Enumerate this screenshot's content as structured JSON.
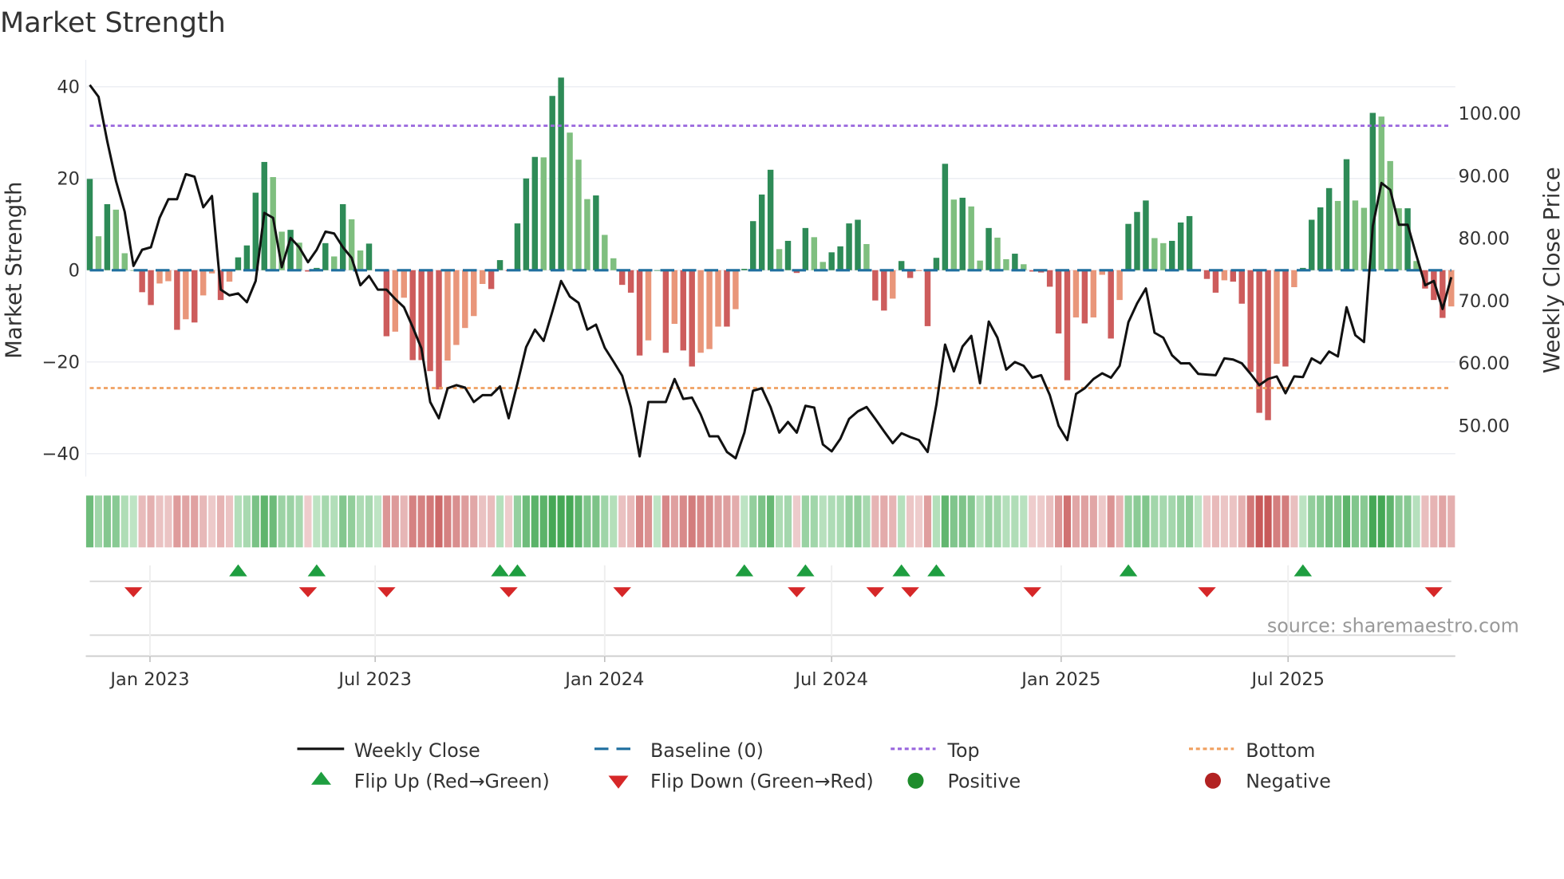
{
  "chart_data": {
    "type": "bar",
    "title": "Market Strength",
    "ylabel": "Market Strength",
    "y2label": "Weekly Close Price",
    "ylim": [
      -44,
      44
    ],
    "y2lim": [
      44.3,
      106.4
    ],
    "yticks": [
      "40",
      "20",
      "0",
      "−20",
      "−40"
    ],
    "ytick_values": [
      40,
      20,
      0,
      -20,
      -40
    ],
    "y2ticks": [
      "100.00",
      "90.00",
      "80.00",
      "70.00",
      "60.00",
      "50.00"
    ],
    "y2tick_values": [
      100,
      90,
      80,
      70,
      60,
      50
    ],
    "xticks": [
      {
        "label": "Jan 2023",
        "week": 6.9
      },
      {
        "label": "Jul 2023",
        "week": 32.7
      },
      {
        "label": "Jan 2024",
        "week": 59
      },
      {
        "label": "Jul 2024",
        "week": 85
      },
      {
        "label": "Jan 2025",
        "week": 111.3
      },
      {
        "label": "Jul 2025",
        "week": 137.3
      }
    ],
    "top_threshold": 31.5,
    "bottom_threshold": -25.7,
    "baseline": 0,
    "strength": [
      19.9,
      7.4,
      14.4,
      13.2,
      3.7,
      0,
      -4.8,
      -7.6,
      -2.9,
      -2.4,
      -13,
      -10.7,
      -11.4,
      -5.5,
      -0.7,
      -6.5,
      -2.5,
      2.8,
      5.4,
      16.9,
      23.6,
      20.3,
      8.4,
      8.8,
      6,
      -0.3,
      0.5,
      5.9,
      3,
      14.4,
      11.1,
      4.3,
      5.8,
      0,
      -14.4,
      -13.4,
      -6,
      -19.6,
      -19.6,
      -22,
      -26,
      -19.7,
      -16.3,
      -12.6,
      -10,
      -3,
      -4.1,
      2.2,
      -0.2,
      10.2,
      20,
      24.7,
      24.6,
      38,
      42,
      30,
      24.1,
      15.5,
      16.3,
      7.7,
      2.6,
      -3.2,
      -4.9,
      -18.6,
      -15.3,
      0,
      -18,
      -11.7,
      -17.5,
      -21,
      -18,
      -17.2,
      -12.3,
      -12.3,
      -8.5,
      0.3,
      10.7,
      16.5,
      21.9,
      4.6,
      6.4,
      -0.6,
      9.2,
      7.2,
      1.8,
      3.9,
      5.2,
      10.2,
      11,
      5.7,
      -6.6,
      -8.8,
      -6.2,
      2.0,
      -1.7,
      -0.2,
      -12.2,
      2.7,
      23.2,
      15.4,
      15.8,
      13.9,
      2.1,
      9.2,
      7.1,
      2.4,
      3.6,
      1.3,
      -0.3,
      -0.5,
      -3.6,
      -13.8,
      -24,
      -10.3,
      -11.6,
      -10.3,
      -1,
      -14.9,
      -6.5,
      10.1,
      12.7,
      15.2,
      7,
      5.9,
      6.4,
      10.4,
      11.8,
      0.2,
      -1.9,
      -4.9,
      -2.2,
      -2.5,
      -7.3,
      -22.2,
      -31.1,
      -32.7,
      -20.4,
      -21,
      -3.7,
      0.5,
      11,
      13.7,
      17.9,
      15.1,
      24.2,
      15.2,
      13.6,
      34.3,
      33.5,
      23.8,
      13.5,
      13.5,
      2,
      -4,
      -6.5,
      -10.4,
      -7.9
    ],
    "weekly_close": [
      104.6,
      102.7,
      95.6,
      89.2,
      84.3,
      75.6,
      78.2,
      78.6,
      83.3,
      86.3,
      86.3,
      90.3,
      89.9,
      85,
      86.8,
      71.8,
      70.9,
      71.2,
      69.8,
      73.2,
      84.1,
      83.3,
      75.4,
      80.1,
      78.6,
      76.2,
      78.2,
      81.1,
      80.8,
      78.6,
      76.9,
      72.5,
      74,
      71.8,
      71.8,
      70.3,
      69,
      65.8,
      62.4,
      53.8,
      51.2,
      56,
      56.5,
      56.1,
      53.8,
      54.9,
      54.9,
      56.3,
      51.2,
      56.8,
      62.6,
      65.4,
      63.6,
      68.3,
      73.2,
      70.7,
      69.7,
      65.4,
      66.2,
      62.5,
      60.3,
      58,
      53,
      45.1,
      53.8,
      53.8,
      53.8,
      57.5,
      54.3,
      54.5,
      51.8,
      48.3,
      48.3,
      45.8,
      44.8,
      48.9,
      55.6,
      56,
      53,
      48.9,
      50.6,
      48.9,
      53.2,
      52.9,
      47,
      45.9,
      47.9,
      51.1,
      52.3,
      53,
      51.1,
      49.1,
      47.2,
      48.8,
      48.2,
      47.7,
      45.8,
      53.4,
      63,
      58.7,
      62.7,
      64.4,
      56.8,
      66.7,
      64.1,
      59,
      60.2,
      59.6,
      57.7,
      58.1,
      54.9,
      50,
      47.7,
      55.1,
      56,
      57.5,
      58.4,
      57.7,
      59.6,
      66.6,
      69.6,
      72,
      64.9,
      64.1,
      61.3,
      60,
      60,
      58.3,
      58.2,
      58.1,
      60.8,
      60.6,
      60,
      58.3,
      56.5,
      57.5,
      57.9,
      55.2,
      57.9,
      57.8,
      60.8,
      60,
      61.9,
      61.1,
      69,
      64.5,
      63.4,
      82,
      88.9,
      87.8,
      82.2,
      82.2,
      77.3,
      72.5,
      73.2,
      68.7,
      73.8
    ],
    "flip_up_weeks": [
      17,
      26,
      47,
      49,
      75,
      82,
      93,
      97,
      119,
      139
    ],
    "flip_down_weeks": [
      5,
      25,
      34,
      48,
      61,
      81,
      90,
      94,
      108,
      128,
      154
    ],
    "legend": {
      "placement": "bottom",
      "items": [
        {
          "label": "Weekly Close",
          "color": "#111111"
        },
        {
          "label": "Baseline (0)",
          "color": "#1f6f9f"
        },
        {
          "label": "Top",
          "color": "#9966dd"
        },
        {
          "label": "Bottom",
          "color": "#f0a060"
        },
        {
          "label": "Flip Up (Red→Green)",
          "color": "#1e9e40"
        },
        {
          "label": "Flip Down (Green→Red)",
          "color": "#d62728"
        },
        {
          "label": "Positive",
          "color": "#1e8c2c"
        },
        {
          "label": "Negative",
          "color": "#b22222"
        }
      ]
    },
    "source": "source: sharemaestro.com",
    "colors": {
      "pos_up": "#2e8b57",
      "pos_down": "#7fbf7f",
      "neg_down": "#cd5c5c",
      "neg_up": "#e9967a"
    }
  }
}
